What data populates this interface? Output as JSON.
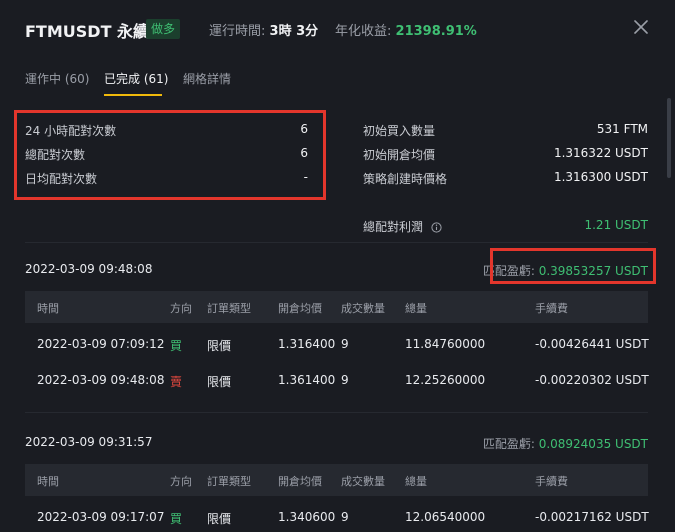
{
  "header": {
    "symbol": "FTMUSDT 永續",
    "direction_badge": "做多",
    "runtime_label": "運行時間:",
    "runtime_value": "3時 3分",
    "annual_label": "年化收益:",
    "annual_value": "21398.91%"
  },
  "tabs": [
    {
      "label": "運作中 (60)",
      "active": false
    },
    {
      "label": "已完成 (61)",
      "active": true
    },
    {
      "label": "網格詳情",
      "active": false
    }
  ],
  "stats_left": [
    {
      "label": "24 小時配對次數",
      "value": "6"
    },
    {
      "label": "總配對次數",
      "value": "6"
    },
    {
      "label": "日均配對次數",
      "value": "-"
    }
  ],
  "stats_right": [
    {
      "label": "初始買入數量",
      "value": "531 FTM"
    },
    {
      "label": "初始開倉均價",
      "value": "1.316322 USDT"
    },
    {
      "label": "策略創建時價格",
      "value": "1.316300 USDT"
    }
  ],
  "total_profit": {
    "label": "總配對利潤",
    "value": "1.21 USDT"
  },
  "columns": [
    "時間",
    "方向",
    "訂單類型",
    "開倉均價",
    "成交數量",
    "總量",
    "手續費"
  ],
  "records": [
    {
      "date": "2022-03-09 09:48:08",
      "profit_label": "匹配盈虧:",
      "profit_value": "0.39853257 USDT",
      "rows": [
        {
          "time": "2022-03-09 07:09:12",
          "side": "買",
          "type": "限價",
          "price": "1.316400",
          "qty": "9",
          "total": "11.84760000",
          "fee": "-0.00426441 USDT"
        },
        {
          "time": "2022-03-09 09:48:08",
          "side": "賣",
          "type": "限價",
          "price": "1.361400",
          "qty": "9",
          "total": "12.25260000",
          "fee": "-0.00220302 USDT"
        }
      ]
    },
    {
      "date": "2022-03-09 09:31:57",
      "profit_label": "匹配盈虧:",
      "profit_value": "0.08924035 USDT",
      "rows": [
        {
          "time": "2022-03-09 09:17:07",
          "side": "買",
          "type": "限價",
          "price": "1.340600",
          "qty": "9",
          "total": "12.06540000",
          "fee": "-0.00217162 USDT"
        }
      ]
    }
  ],
  "colors": {
    "accent": "#f0b90b",
    "buy": "#3fbf73",
    "sell": "#e3483f",
    "highlight_box": "#e3362c"
  }
}
